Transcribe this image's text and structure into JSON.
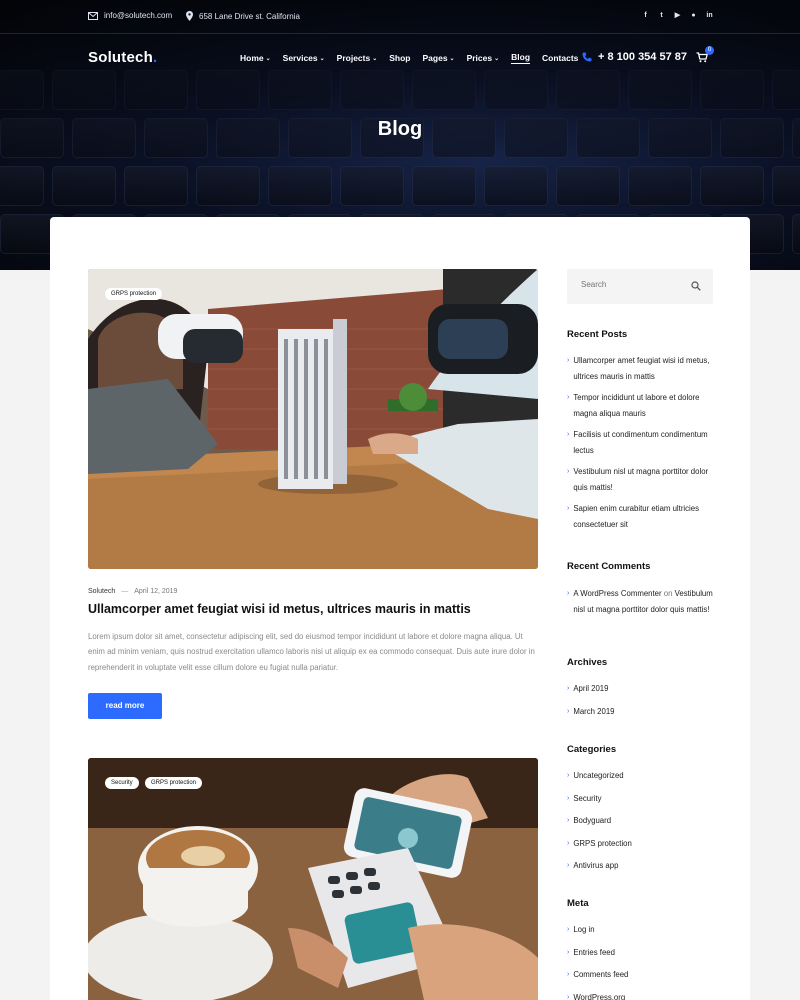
{
  "topbar": {
    "email": "info@solutech.com",
    "address": "658 Lane Drive st. California",
    "socials": [
      "facebook-icon",
      "twitter-icon",
      "youtube-icon",
      "github-icon",
      "linkedin-icon"
    ]
  },
  "nav": {
    "logo": "Solutech",
    "logo_dot": ".",
    "menu": [
      {
        "label": "Home",
        "dropdown": true
      },
      {
        "label": "Services",
        "dropdown": true
      },
      {
        "label": "Projects",
        "dropdown": true
      },
      {
        "label": "Shop",
        "dropdown": false
      },
      {
        "label": "Pages",
        "dropdown": true
      },
      {
        "label": "Prices",
        "dropdown": true
      },
      {
        "label": "Blog",
        "dropdown": false,
        "active": true
      },
      {
        "label": "Contacts",
        "dropdown": false
      }
    ],
    "phone": "+ 8 100 354 57 87",
    "cart_count": "0"
  },
  "hero": {
    "title": "Blog"
  },
  "posts": [
    {
      "tags": [
        "GRPS protection"
      ],
      "author": "Solutech",
      "date": "April 12, 2019",
      "title": "Ullamcorper amet feugiat wisi id metus, ultrices mauris in mattis",
      "excerpt": "Lorem ipsum dolor sit amet, consectetur adipiscing elit, sed do eiusmod tempor incididunt ut labore et dolore magna aliqua. Ut enim ad minim veniam, quis nostrud exercitation ullamco laboris nisi ut aliquip ex ea commodo consequat. Duis aute irure dolor in reprehenderit in voluptate velit esse cillum dolore eu fugiat nulla pariatur.",
      "button": "read more"
    },
    {
      "tags": [
        "Security",
        "GRPS protection"
      ]
    }
  ],
  "sidebar": {
    "search_placeholder": "Search",
    "recent_posts_title": "Recent Posts",
    "recent_posts": [
      "Ullamcorper amet feugiat wisi id metus, ultrices mauris in mattis",
      "Tempor incididunt ut labore et dolore magna aliqua mauris",
      "Facilisis ut condimentum condimentum lectus",
      "Vestibulum nisl ut magna porttitor dolor quis mattis!",
      "Sapien enim curabitur etiam ultricies consectetuer sit"
    ],
    "recent_comments_title": "Recent Comments",
    "comment_author": "A WordPress Commenter",
    "comment_on": "on",
    "comment_post": "Vestibulum nisl ut magna porttitor dolor quis mattis!",
    "archives_title": "Archives",
    "archives": [
      "April 2019",
      "March 2019"
    ],
    "categories_title": "Categories",
    "categories": [
      "Uncategorized",
      "Security",
      "Bodyguard",
      "GRPS protection",
      "Antivirus app"
    ],
    "meta_title": "Meta",
    "meta": [
      "Log in",
      "Entries feed",
      "Comments feed",
      "WordPress.org"
    ]
  },
  "colors": {
    "accent": "#2d6bff",
    "hero_dark": "#0d152e"
  }
}
